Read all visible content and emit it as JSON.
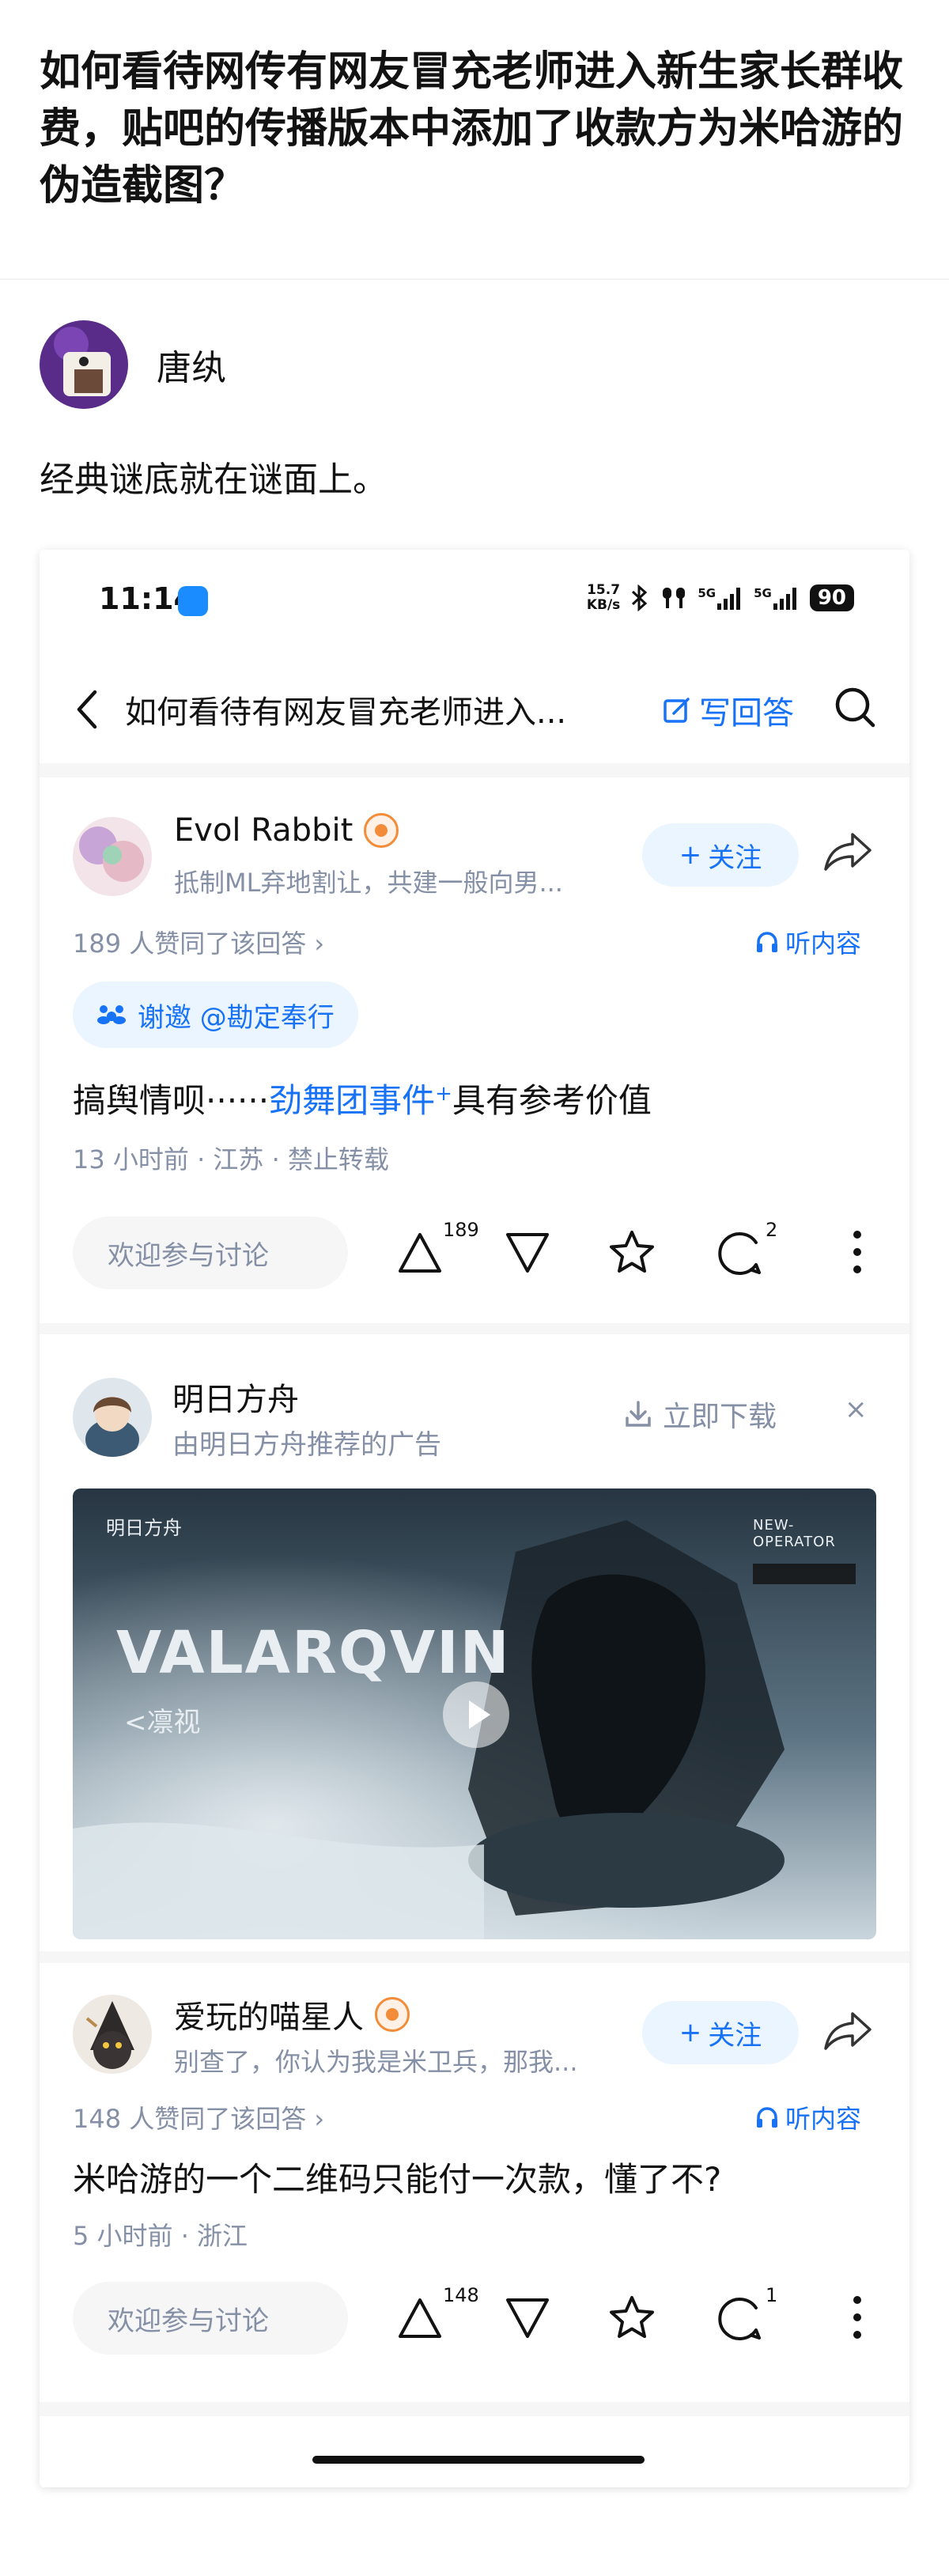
{
  "question": {
    "title": "如何看待网传有网友冒充老师进入新生家长群收费，贴吧的传播版本中添加了收款方为米哈游的伪造截图？"
  },
  "answer": {
    "author": "唐纨",
    "text": "经典谜底就在谜面上。"
  },
  "screenshot": {
    "statusbar": {
      "time": "11:14",
      "netspeed_value": "15.7",
      "netspeed_unit": "KB/s",
      "net_label_1": "5G",
      "net_label_2": "5G",
      "battery": "90"
    },
    "navbar": {
      "title": "如何看待有网友冒充老师进入...",
      "write_label": "写回答"
    },
    "cards": [
      {
        "user": "Evol Rabbit",
        "bio": "抵制ML弃地割让，共建一般向男...",
        "follow": "关注",
        "likes": "189 人赞同了该回答 ›",
        "listen": "听内容",
        "invite": "谢邀 @勘定奉行",
        "content_prefix": "搞舆情呗······",
        "content_link": "劲舞团事件",
        "content_link_mark": "+",
        "content_suffix": "具有参考价值",
        "meta": "13 小时前 · 江苏 · 禁止转载",
        "comment_placeholder": "欢迎参与讨论",
        "upvotes": "189",
        "comments": "2"
      },
      {
        "user": "爱玩的喵星人",
        "bio": "别查了，你认为我是米卫兵，那我...",
        "follow": "关注",
        "likes": "148 人赞同了该回答 ›",
        "listen": "听内容",
        "content": "米哈游的一个二维码只能付一次款，懂了不?",
        "meta": "5 小时前 · 浙江",
        "comment_placeholder": "欢迎参与讨论",
        "upvotes": "148",
        "comments": "1"
      }
    ],
    "ad": {
      "name": "明日方舟",
      "sub": "由明日方舟推荐的广告",
      "download": "立即下载",
      "close": "×",
      "image_brand": "明日方舟",
      "image_title": "VALARQVIN",
      "image_sub": "<凛视",
      "image_tag": "NEW-OPERATOR"
    }
  },
  "colors": {
    "accent": "#1772f6",
    "muted": "#8590a6",
    "text": "#121212"
  }
}
